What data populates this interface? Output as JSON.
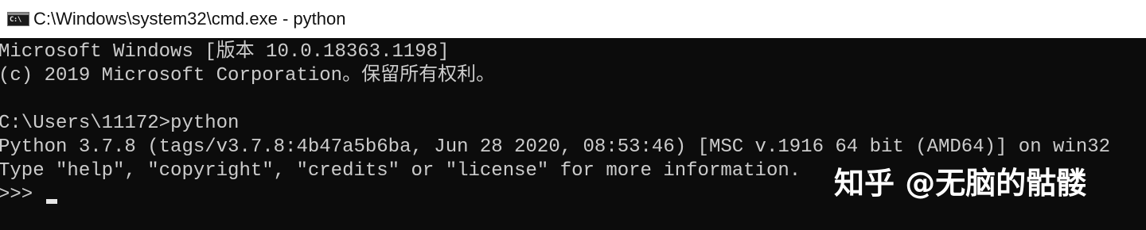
{
  "window": {
    "title": "C:\\Windows\\system32\\cmd.exe - python",
    "icon": "cmd-console-icon",
    "icon_text": "C:\\"
  },
  "console": {
    "lines": [
      "Microsoft Windows [版本 10.0.18363.1198]",
      "(c) 2019 Microsoft Corporation。保留所有权利。",
      "",
      "C:\\Users\\11172>python",
      "Python 3.7.8 (tags/v3.7.8:4b47a5b6ba, Jun 28 2020, 08:53:46) [MSC v.1916 64 bit (AMD64)] on win32",
      "Type \"help\", \"copyright\", \"credits\" or \"license\" for more information.",
      ">>> "
    ],
    "text_color": "#cccccc",
    "background_color": "#0c0c0c"
  },
  "watermark": {
    "text": "知乎 @无脑的骷髅"
  }
}
